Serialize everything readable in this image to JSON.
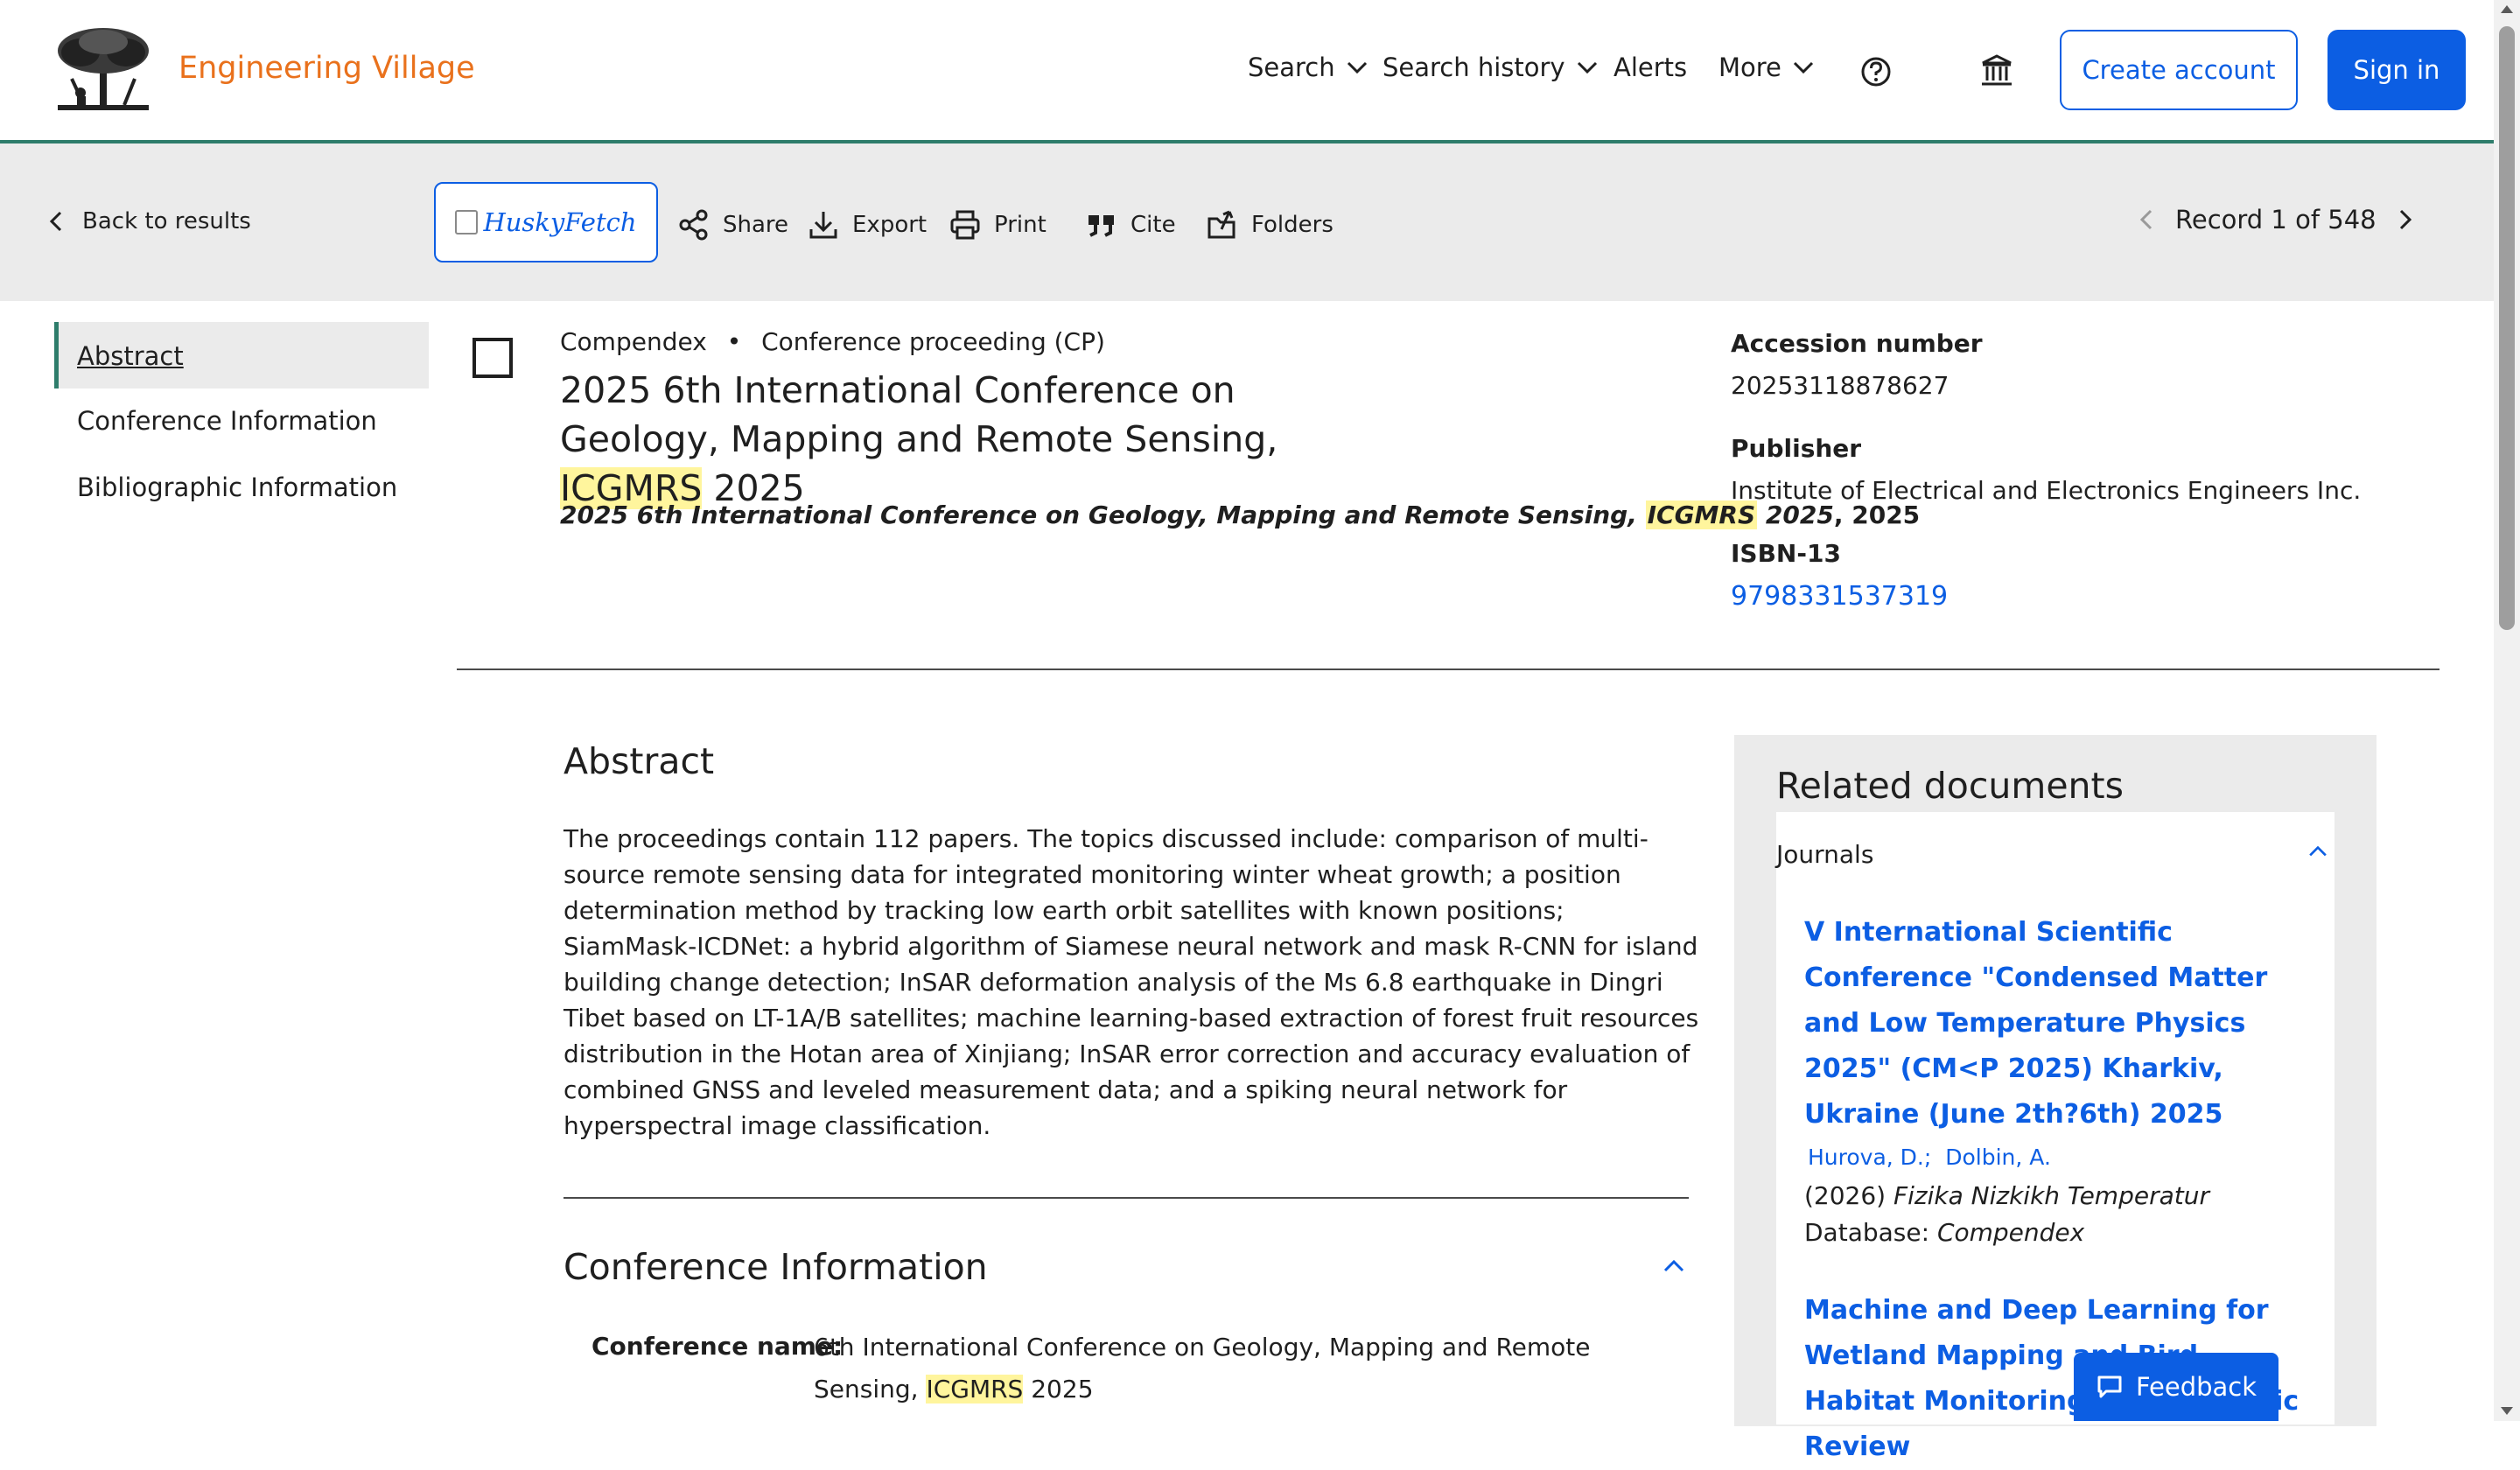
{
  "header": {
    "brand": "Engineering Village",
    "nav": {
      "search": "Search",
      "search_history": "Search history",
      "alerts": "Alerts",
      "more": "More"
    },
    "create_account": "Create account",
    "sign_in": "Sign in"
  },
  "toolbar": {
    "back": "Back to results",
    "husky": "HuskyFetch",
    "share": "Share",
    "export": "Export",
    "print": "Print",
    "cite": "Cite",
    "folders": "Folders",
    "record": "Record 1 of 548"
  },
  "sidebar": {
    "items": [
      {
        "label": "Abstract"
      },
      {
        "label": "Conference Information"
      },
      {
        "label": "Bibliographic Information"
      }
    ]
  },
  "record": {
    "database": "Compendex",
    "bullet": "•",
    "doc_type": "Conference proceeding (CP)",
    "title_part1": "2025 6th International Conference on Geology, Mapping and Remote Sensing, ",
    "title_highlight": "ICGMRS",
    "title_part2": " 2025",
    "source_part1": "2025 6th International Conference on Geology, Mapping and Remote Sensing, ",
    "source_highlight": "ICGMRS",
    "source_part2": " 2025",
    "source_year": ", 2025",
    "accession_label": "Accession number",
    "accession_value": "20253118878627",
    "publisher_label": "Publisher",
    "publisher_value": "Institute of Electrical and Electronics Engineers Inc.",
    "isbn_label": "ISBN-13",
    "isbn_value": "9798331537319"
  },
  "abstract": {
    "heading": "Abstract",
    "text": "The proceedings contain 112 papers. The topics discussed include: comparison of multi-source remote sensing data for integrated monitoring winter wheat growth; a position determination method by tracking low earth orbit satellites with known positions; SiamMask-ICDNet: a hybrid algorithm of Siamese neural network and mask R-CNN for island building change detection; InSAR deformation analysis of the Ms 6.8 earthquake in Dingri Tibet based on LT-1A/B satellites; machine learning-based extraction of forest fruit resources distribution in the Hotan area of Xinjiang; InSAR error correction and accuracy evaluation of combined GNSS and leveled measurement data; and a spiking neural network for hyperspectral image classification."
  },
  "conference": {
    "heading": "Conference Information",
    "name_label": "Conference name:",
    "name_part1": "6th International Conference on Geology, Mapping and Remote Sensing, ",
    "name_highlight": "ICGMRS",
    "name_part2": " 2025"
  },
  "related": {
    "heading": "Related documents",
    "section": "Journals",
    "item1_title": "V International Scientific Conference \"Condensed Matter and Low Temperature Physics 2025\" (CM<P 2025) Kharkiv, Ukraine (June 2th?6th) 2025",
    "item1_author1": "Hurova, D.;",
    "item1_author2": "Dolbin, A.",
    "item1_year": "(2026) ",
    "item1_journal": "Fizika Nizkikh Temperatur",
    "item1_db_label": "Database: ",
    "item1_db": "Compendex",
    "item2_title": "Machine and Deep Learning for Wetland Mapping and Bird-Habitat Monitoring: A Systematic Review"
  },
  "feedback": "Feedback",
  "colors": {
    "brand_orange": "#e9711c",
    "link_blue": "#0c5ee3",
    "accent_green": "#2e7d6b",
    "highlight_yellow": "#fff59d"
  }
}
